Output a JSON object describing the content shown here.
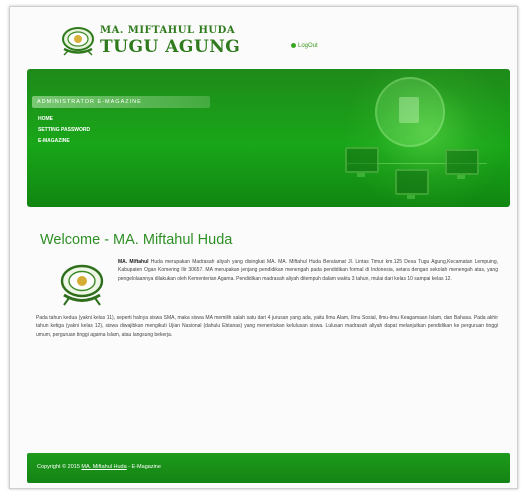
{
  "header": {
    "logo_line1": "MA. MIFTAHUL HUDA",
    "logo_line2": "TUGU AGUNG",
    "logout_label": "LogOut"
  },
  "banner": {
    "admin_title": "ADMINISTRATOR E-MAGAZINE",
    "menu": [
      {
        "label": "HOME"
      },
      {
        "label": "SETTING PASSWORD"
      },
      {
        "label": "E-MAGAZINE"
      }
    ]
  },
  "main": {
    "title": "Welcome - MA. Miftahul Huda",
    "school_name": "MA. Miftahul",
    "paragraph1_rest": " Huda merupakan Madrasah aliyah yang disingkat MA. MA. Miftahul Huda Beralamat Jl. Lintas Timur km.125 Desa Tugu Agung,Kecamatan Lempuing, Kabupaten Ogan Komering Ilir 30657. MA merupakan jenjang pendidikan menengah pada pendidikan formal di Indonesia, setara dengan sekolah menengah atas, yang pengelolaannya dilakukan oleh Kementerian Agama. Pendidikan madrasah aliyah ditempuh dalam waktu 3 tahun, mulai dari kelas 10 sampai kelas 12.",
    "paragraph2": "Pada tahun kedua (yakni kelas 11), seperti halnya siswa SMA, maka siswa MA memilih salah satu dari 4 jurusan yang ada, yaitu Ilmu Alam, Ilmu Sosial, Ilmu-ilmu Keagamaan Islam, dan Bahasa. Pada akhir tahun ketiga (yakni kelas 12), siswa diwajibkan mengikuti Ujian Nasional (dahulu Ebtanas) yang menentukan kelulusan siswa. Lulusan madrasah aliyah dapat melanjutkan pendidikan ke perguruan tinggi umum, perguruan tinggi agama Islam, atau langsung bekerja."
  },
  "footer": {
    "prefix": "Copyright © 2015 ",
    "link": "MA. Miftahul Huda",
    "suffix": " - E-Magazine"
  },
  "colors": {
    "brand_green": "#1f9a1c",
    "title_green": "#2e8f24",
    "logo_green": "#2f7a1c"
  }
}
